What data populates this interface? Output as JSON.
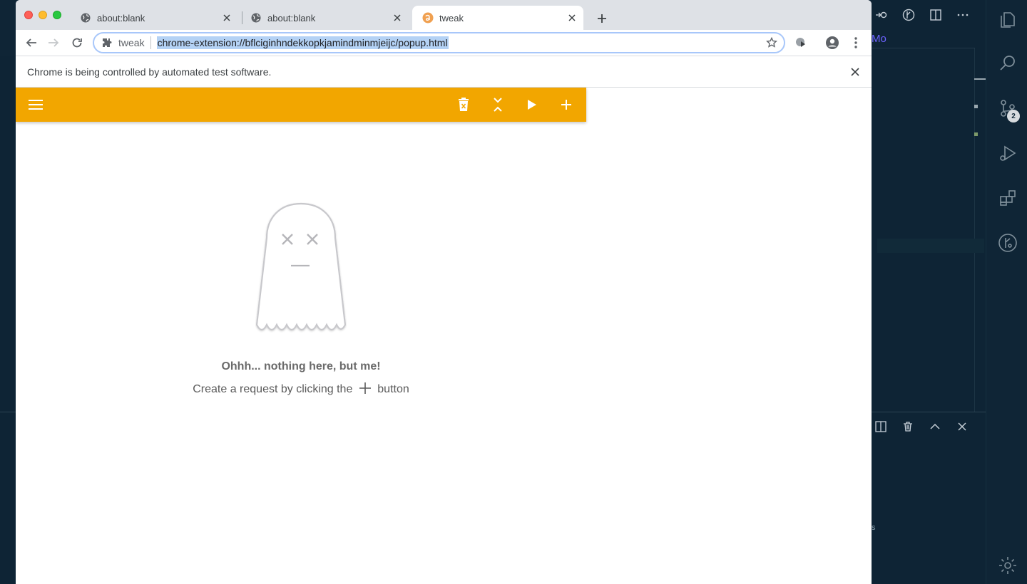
{
  "browser": {
    "tabs": [
      {
        "title": "about:blank",
        "active": false
      },
      {
        "title": "about:blank",
        "active": false
      },
      {
        "title": "tweak",
        "active": true
      }
    ],
    "omnibox": {
      "site_name": "tweak",
      "url": "chrome-extension://bflciginhndekkopkjamindminmjeijc/popup.html"
    },
    "infobar": {
      "message": "Chrome is being controlled by automated test software."
    }
  },
  "app": {
    "toolbar_color": "#f2a600",
    "toolbar_buttons": [
      "menu-icon",
      "delete-all-icon",
      "collapse-all-icon",
      "play-icon",
      "add-icon"
    ],
    "empty_state": {
      "title": "Ohhh... nothing here, but me!",
      "subtitle_before": "Create a request by clicking the",
      "subtitle_after": "button"
    }
  },
  "vscode_background": {
    "tab_fragment": "Mo",
    "scm_badge": "2",
    "stray_text": "s"
  }
}
